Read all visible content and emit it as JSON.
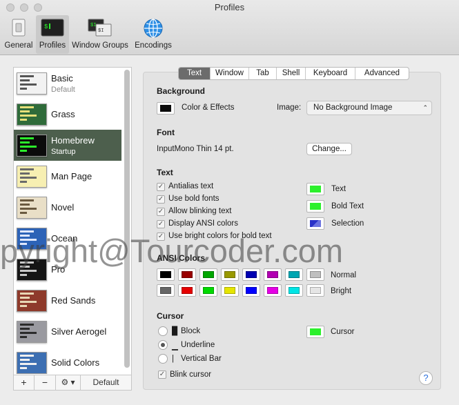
{
  "window": {
    "title": "Profiles"
  },
  "toolbar": [
    {
      "label": "General",
      "icon": "general-switch-icon"
    },
    {
      "label": "Profiles",
      "icon": "terminal-profile-icon"
    },
    {
      "label": "Window Groups",
      "icon": "window-groups-icon"
    },
    {
      "label": "Encodings",
      "icon": "globe-icon"
    }
  ],
  "profiles": [
    {
      "name": "Basic",
      "sub": "Default",
      "bg": "#f2f2f2",
      "fg": "#555555"
    },
    {
      "name": "Grass",
      "sub": "",
      "bg": "#2f6b3a",
      "fg": "#e6e07a"
    },
    {
      "name": "Homebrew",
      "sub": "Startup",
      "bg": "#0b0b0b",
      "fg": "#2cf02c"
    },
    {
      "name": "Man Page",
      "sub": "",
      "bg": "#f7efb2",
      "fg": "#6a6a6a"
    },
    {
      "name": "Novel",
      "sub": "",
      "bg": "#e9dfc7",
      "fg": "#6a5a40"
    },
    {
      "name": "Ocean",
      "sub": "",
      "bg": "#2d63b7",
      "fg": "#e0e8ff"
    },
    {
      "name": "Pro",
      "sub": "",
      "bg": "#151515",
      "fg": "#c8c8c8"
    },
    {
      "name": "Red Sands",
      "sub": "",
      "bg": "#8e3a2b",
      "fg": "#e8d7b5"
    },
    {
      "name": "Silver Aerogel",
      "sub": "",
      "bg": "#9a9aa0",
      "fg": "#2b2b2b"
    },
    {
      "name": "Solid Colors",
      "sub": "",
      "bg": "#3d6fb2",
      "fg": "#f0f0f0"
    }
  ],
  "sidebar_footer": {
    "add": "+",
    "remove": "−",
    "gear": "⚙ ▾",
    "default": "Default"
  },
  "tabs": [
    "Text",
    "Window",
    "Tab",
    "Shell",
    "Keyboard",
    "Advanced"
  ],
  "background": {
    "heading": "Background",
    "color_label": "Color & Effects",
    "color": "#0b0b0b",
    "image_label": "Image:",
    "image_value": "No Background Image"
  },
  "font": {
    "heading": "Font",
    "value": "InputMono Thin 14 pt.",
    "change_label": "Change..."
  },
  "text": {
    "heading": "Text",
    "options": [
      {
        "label": "Antialias text",
        "checked": true
      },
      {
        "label": "Use bold fonts",
        "checked": true
      },
      {
        "label": "Allow blinking text",
        "checked": true
      },
      {
        "label": "Display ANSI colors",
        "checked": true
      },
      {
        "label": "Use bright colors for bold text",
        "checked": true
      }
    ],
    "colors": [
      {
        "label": "Text",
        "color": "#2cf02c"
      },
      {
        "label": "Bold Text",
        "color": "#2cf02c"
      },
      {
        "label": "Selection",
        "color": "#2a32c8"
      }
    ]
  },
  "ansi": {
    "heading": "ANSI Colors",
    "normal_label": "Normal",
    "bright_label": "Bright",
    "normal": [
      "#000000",
      "#990000",
      "#00a600",
      "#999900",
      "#0000b2",
      "#b200b2",
      "#00a6b2",
      "#bfbfbf"
    ],
    "bright": [
      "#666666",
      "#e50000",
      "#00d900",
      "#e5e500",
      "#0000ff",
      "#e500e5",
      "#00e5e5",
      "#e5e5e5"
    ]
  },
  "cursor": {
    "heading": "Cursor",
    "options": [
      {
        "glyph": "█",
        "label": "Block",
        "selected": false
      },
      {
        "glyph": "▁",
        "label": "Underline",
        "selected": true
      },
      {
        "glyph": "|",
        "label": "Vertical Bar",
        "selected": false
      }
    ],
    "blink_label": "Blink cursor",
    "blink_checked": true,
    "color_label": "Cursor",
    "color": "#2cf02c"
  },
  "help": "?",
  "watermark": "pyright@Tourcoder.com"
}
